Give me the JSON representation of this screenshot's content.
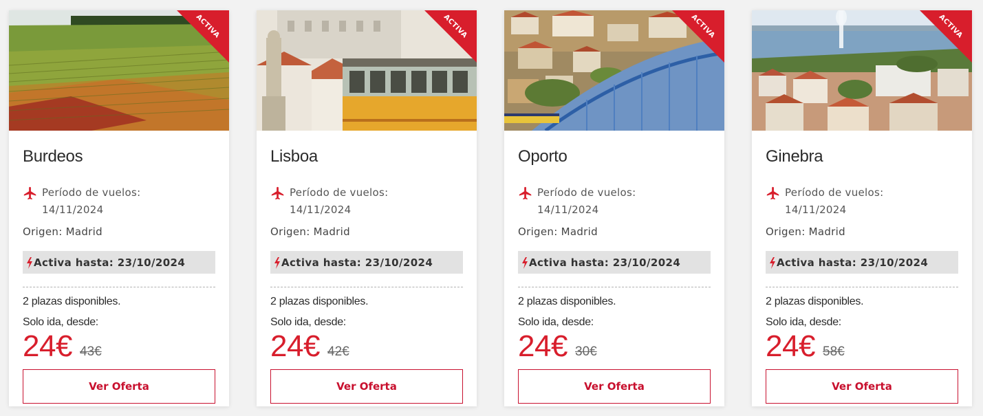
{
  "colors": {
    "brand_red": "#d81e2c",
    "button_border": "#c8102e",
    "active_box_bg": "#e2e2e2",
    "page_bg": "#f2f2f2"
  },
  "icons": {
    "plane": "airplane-icon",
    "bolt": "lightning-bolt-icon"
  },
  "cards": [
    {
      "ribbon": "ACTIVA",
      "city": "Burdeos",
      "period_label": "Período de vuelos:",
      "period_date": "14/11/2024",
      "origin": "Origen: Madrid",
      "active_until": "Activa hasta: 23/10/2024",
      "seats": "2 plazas disponibles.",
      "oneway": "Solo ida, desde:",
      "price": "24€",
      "old_price": "43€",
      "button": "Ver Oferta"
    },
    {
      "ribbon": "ACTIVA",
      "city": "Lisboa",
      "period_label": "Período de vuelos:",
      "period_date": "14/11/2024",
      "origin": "Origen: Madrid",
      "active_until": "Activa hasta: 23/10/2024",
      "seats": "2 plazas disponibles.",
      "oneway": "Solo ida, desde:",
      "price": "24€",
      "old_price": "42€",
      "button": "Ver Oferta"
    },
    {
      "ribbon": "ACTIVA",
      "city": "Oporto",
      "period_label": "Período de vuelos:",
      "period_date": "14/11/2024",
      "origin": "Origen: Madrid",
      "active_until": "Activa hasta: 23/10/2024",
      "seats": "2 plazas disponibles.",
      "oneway": "Solo ida, desde:",
      "price": "24€",
      "old_price": "30€",
      "button": "Ver Oferta"
    },
    {
      "ribbon": "ACTIVA",
      "city": "Ginebra",
      "period_label": "Período de vuelos:",
      "period_date": "14/11/2024",
      "origin": "Origen: Madrid",
      "active_until": "Activa hasta: 23/10/2024",
      "seats": "2 plazas disponibles.",
      "oneway": "Solo ida, desde:",
      "price": "24€",
      "old_price": "58€",
      "button": "Ver Oferta"
    }
  ]
}
